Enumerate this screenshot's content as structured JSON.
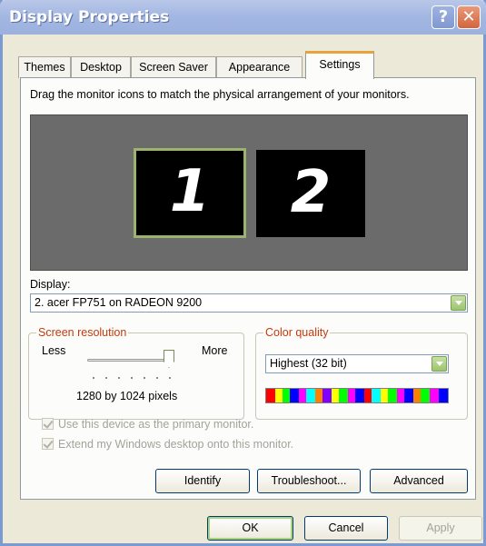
{
  "window": {
    "title": "Display Properties",
    "help_glyph": "?",
    "close_glyph": "✕"
  },
  "tabs": [
    {
      "label": "Themes"
    },
    {
      "label": "Desktop"
    },
    {
      "label": "Screen Saver"
    },
    {
      "label": "Appearance"
    },
    {
      "label": "Settings",
      "active": true
    }
  ],
  "settings": {
    "instruction": "Drag the monitor icons to match the physical arrangement of your monitors.",
    "monitors": [
      {
        "number": "1",
        "selected": true
      },
      {
        "number": "2",
        "selected": false
      }
    ],
    "display_label": "Display:",
    "display_value": "2. acer FP751 on RADEON 9200",
    "resolution": {
      "title": "Screen resolution",
      "less": "Less",
      "more": "More",
      "value_text": "1280 by 1024 pixels",
      "slider_position": 1.0
    },
    "color_quality": {
      "title": "Color quality",
      "value": "Highest (32 bit)"
    },
    "checkboxes": [
      {
        "label": "Use this device as the primary monitor.",
        "checked": true,
        "enabled": false
      },
      {
        "label": "Extend my Windows desktop onto this monitor.",
        "checked": true,
        "enabled": false
      }
    ],
    "buttons": {
      "identify": "Identify",
      "troubleshoot": "Troubleshoot...",
      "advanced": "Advanced"
    }
  },
  "dialog_buttons": {
    "ok": "OK",
    "cancel": "Cancel",
    "apply": "Apply"
  },
  "colors": {
    "titlebar": "#a2b6e2",
    "dialog_bg": "#ECE9D8",
    "active_tab_accent": "#e8a33d",
    "group_title": "#c53a0b",
    "selected_monitor_border": "#9bb36e"
  }
}
